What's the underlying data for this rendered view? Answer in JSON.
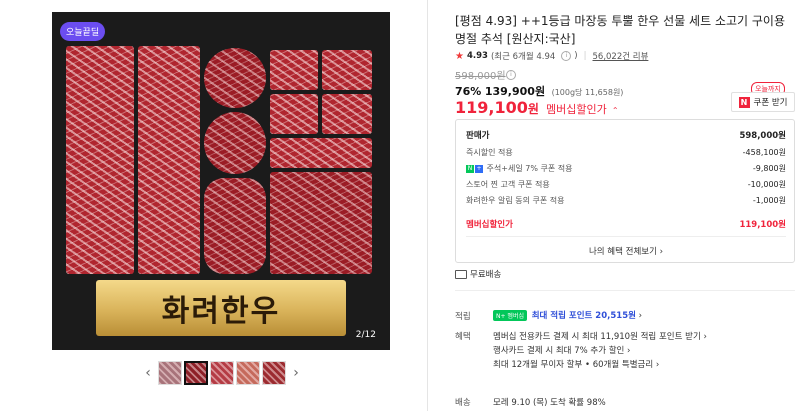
{
  "gallery": {
    "badge": "오늘끝딜",
    "brand_text": "화려한우",
    "counter": "2/12",
    "prev_arrow": "‹",
    "next_arrow": "›"
  },
  "product": {
    "title": "[평점 4.93] ++1등급 마장동 투뿔 한우 선물 세트 소고기 구이용 명절 추석 [원산지:국산]",
    "rating": "4.93",
    "rating_detail": "(최근 6개월 4.94",
    "rating_detail_end": ")",
    "review_count": "56,022건 리뷰",
    "original_price": "598,000원",
    "discount_pct": "76%",
    "sale_price": "139,900원",
    "unit_price": "(100g당 11,658원)",
    "member_price": "119,100",
    "member_won": "원",
    "member_label": "멤버십할인가",
    "coupon_tag": "오늘까지",
    "coupon_button": "쿠폰 받기"
  },
  "breakdown": {
    "head": {
      "label": "판매가",
      "amount": "598,000원"
    },
    "rows": [
      {
        "label": "즉시할인 적용",
        "amount": "-458,100원"
      },
      {
        "label": "주석+세일 7% 쿠폰 적용",
        "amount": "-9,800원"
      },
      {
        "label": "스토어 찐 고객 쿠폰 적용",
        "amount": "-10,000원"
      },
      {
        "label": "화려한우 알림 동의 쿠폰 적용",
        "amount": "-1,000원"
      }
    ],
    "total": {
      "label": "멤버십할인가",
      "amount": "119,100원"
    },
    "benefit_link": "나의 혜택 전체보기 ›"
  },
  "shipping": {
    "free": "무료배송",
    "label": "배송",
    "detail": "모레 9.10 (목) 도착 확률 98%"
  },
  "points": {
    "label": "적립",
    "badge": "N+ 멤버십",
    "text": "최대 적립 포인트 20,515원",
    "chevron": "›"
  },
  "benefits": {
    "label": "혜택",
    "lines": [
      "멤버십 전용카드 결제 시 최대 11,910원 적립 포인트 받기 ›",
      "행사카드 결제 시 최대 7% 추가 할인 ›",
      "최대 12개월 무이자 할부 • 60개월 특별금리 ›"
    ]
  },
  "colors": {
    "accent_red": "#f0233b",
    "naver_green": "#03c75a",
    "point_blue": "#2f4fd8"
  }
}
